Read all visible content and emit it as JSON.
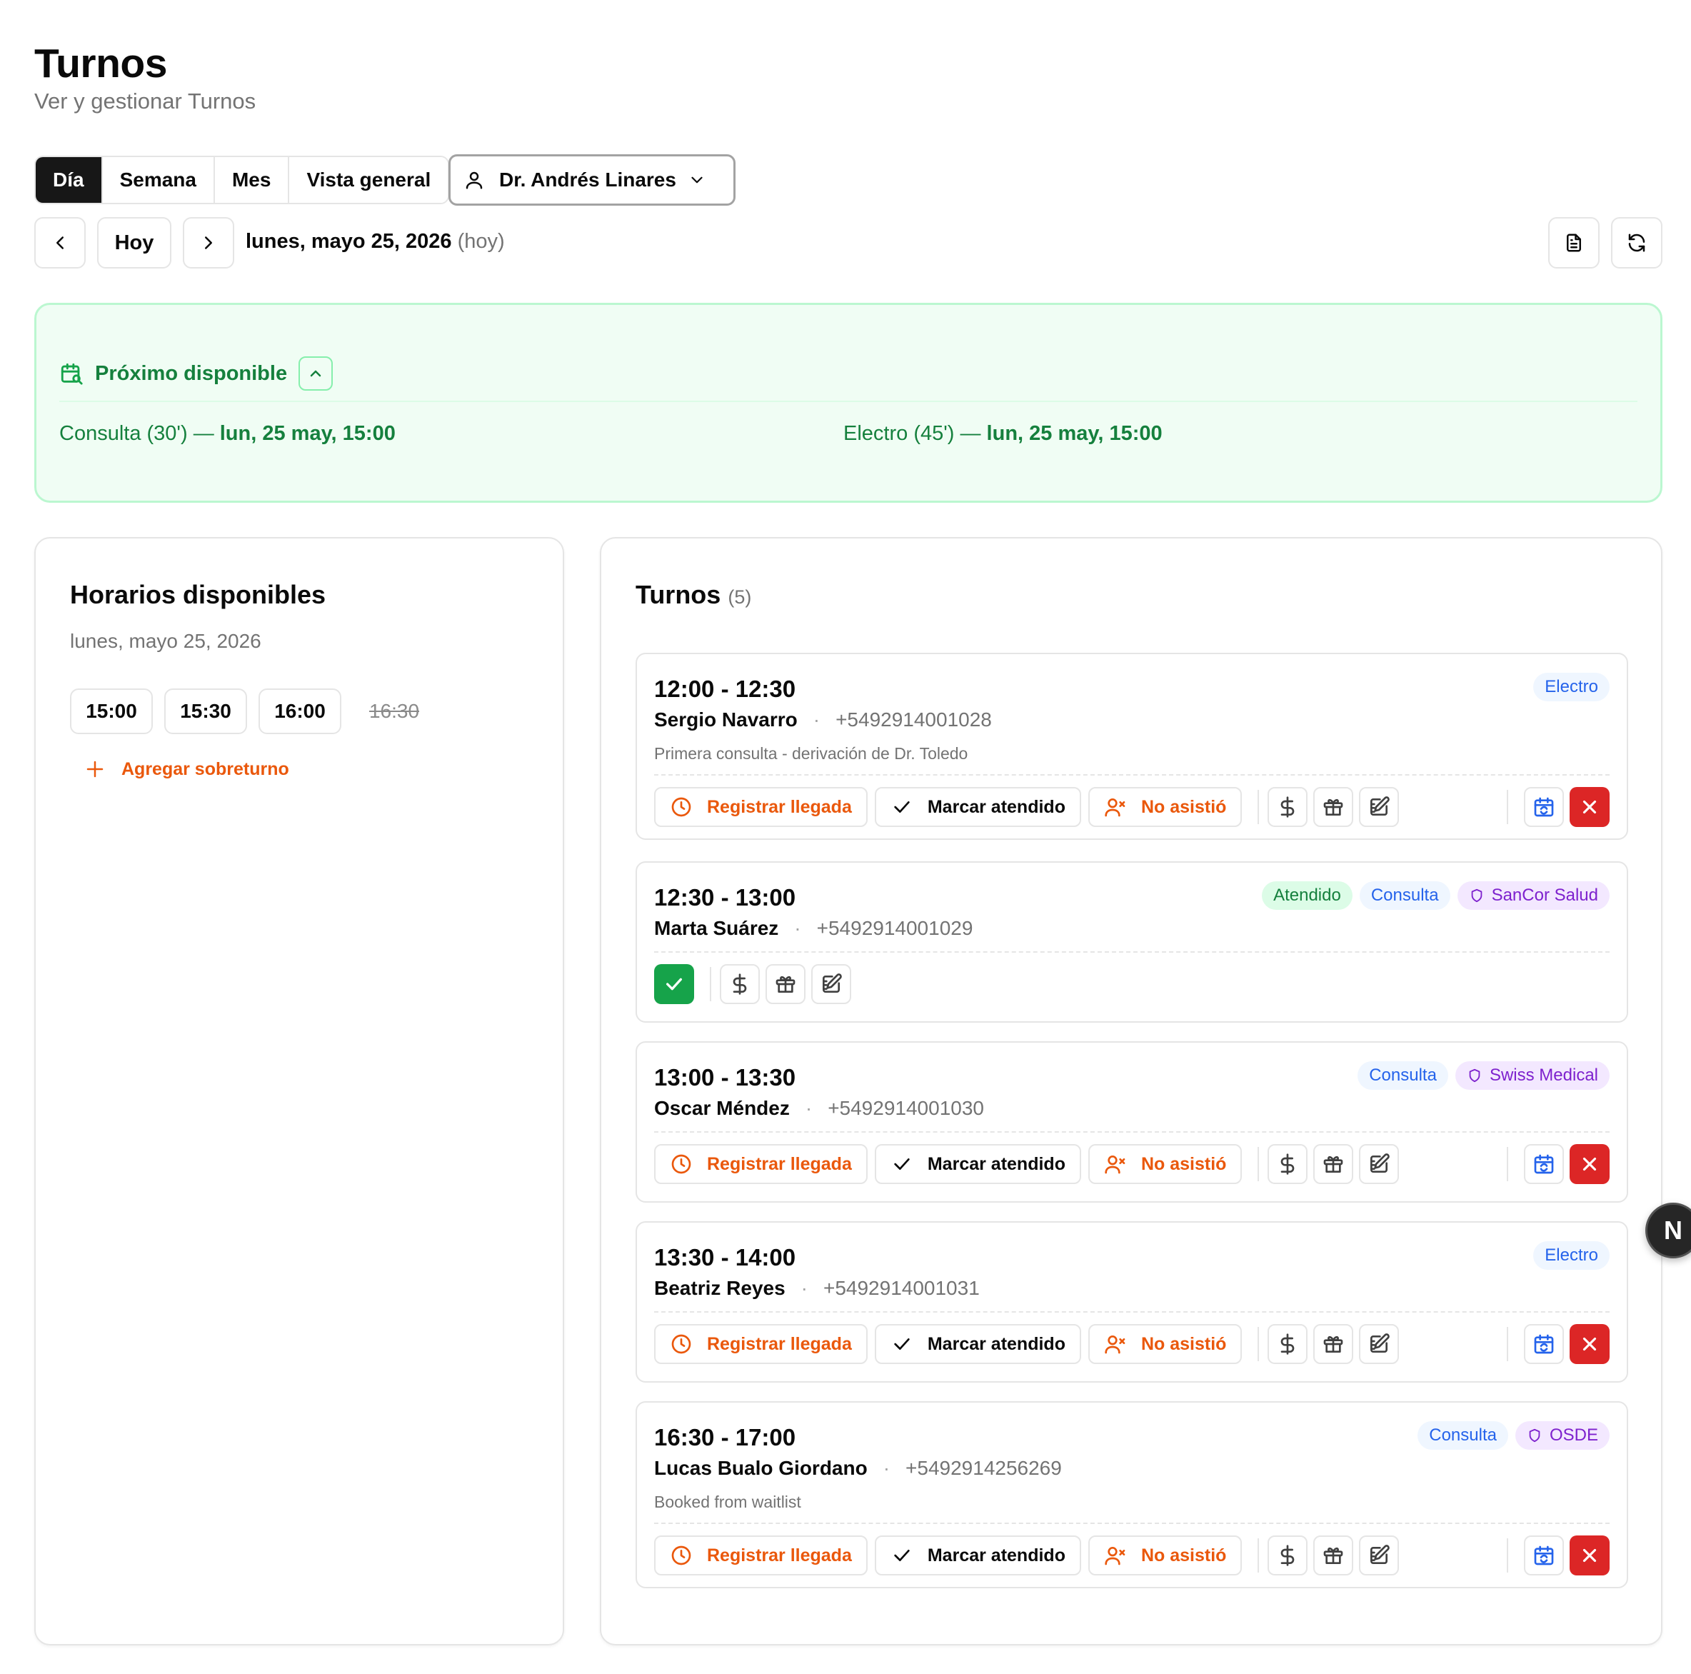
{
  "header": {
    "title": "Turnos",
    "subtitle": "Ver y gestionar Turnos"
  },
  "views": [
    {
      "label": "Día",
      "active": true
    },
    {
      "label": "Semana",
      "active": false
    },
    {
      "label": "Mes",
      "active": false
    },
    {
      "label": "Vista general",
      "active": false
    }
  ],
  "doctor_select": {
    "selected": "Dr. Andrés Linares"
  },
  "date_nav": {
    "today_label": "Hoy",
    "date": "lunes, mayo 25, 2026",
    "today_suffix": "(hoy)"
  },
  "next_available": {
    "title": "Próximo disponible",
    "items": [
      {
        "type": "Consulta (30')",
        "separator": "—",
        "when": "lun, 25 may, 15:00"
      },
      {
        "type": "Electro (45')",
        "separator": "—",
        "when": "lun, 25 may, 15:00"
      }
    ]
  },
  "slots_panel": {
    "title": "Horarios disponibles",
    "date": "lunes, mayo 25, 2026",
    "slots": [
      {
        "time": "15:00",
        "taken": false
      },
      {
        "time": "15:30",
        "taken": false
      },
      {
        "time": "16:00",
        "taken": false
      },
      {
        "time": "16:30",
        "taken": true
      }
    ],
    "add_overbooking": "Agregar sobreturno"
  },
  "appointments_panel": {
    "title": "Turnos",
    "count": "(5)",
    "actions": {
      "arrival": "Registrar llegada",
      "attended": "Marcar atendido",
      "no_show": "No asistió"
    },
    "items": [
      {
        "time": "12:00 - 12:30",
        "name": "Sergio Navarro",
        "phone": "+5492914001028",
        "note": "Primera consulta - derivación de Dr. Toledo",
        "badges": [
          {
            "text": "Electro",
            "color": "blue"
          }
        ]
      },
      {
        "time": "12:30 - 13:00",
        "name": "Marta Suárez",
        "phone": "+5492914001029",
        "note": "",
        "badges": [
          {
            "text": "Atendido",
            "color": "green"
          },
          {
            "text": "Consulta",
            "color": "blue"
          },
          {
            "text": "SanCor Salud",
            "color": "purple"
          }
        ]
      },
      {
        "time": "13:00 - 13:30",
        "name": "Oscar Méndez",
        "phone": "+5492914001030",
        "note": "",
        "badges": [
          {
            "text": "Consulta",
            "color": "blue"
          },
          {
            "text": "Swiss Medical",
            "color": "purple"
          }
        ]
      },
      {
        "time": "13:30 - 14:00",
        "name": "Beatriz Reyes",
        "phone": "+5492914001031",
        "note": "",
        "badges": [
          {
            "text": "Electro",
            "color": "blue"
          }
        ]
      },
      {
        "time": "16:30 - 17:00",
        "name": "Lucas Bualo Giordano",
        "phone": "+5492914256269",
        "note": "Booked from waitlist",
        "badges": [
          {
            "text": "Consulta",
            "color": "blue"
          },
          {
            "text": "OSDE",
            "color": "purple"
          }
        ]
      }
    ]
  },
  "floating_button": {
    "label": "N"
  },
  "icons": {
    "user": "user-icon",
    "chevron": "chevron-down-icon",
    "calendar": "calendar-search-icon",
    "clock": "clock-icon",
    "check": "check-icon",
    "no_show": "user-x-icon",
    "payment": "dollar-icon",
    "gift": "gift-icon",
    "edit": "edit-icon",
    "reschedule": "calendar-sync-icon",
    "cancel": "x-icon",
    "insurance": "shield-icon"
  },
  "colors": {
    "accent_green": "#15803d",
    "orange": "#ea580c",
    "red": "#dc2626",
    "blue": "#2563eb",
    "purple": "#7e22ce"
  }
}
